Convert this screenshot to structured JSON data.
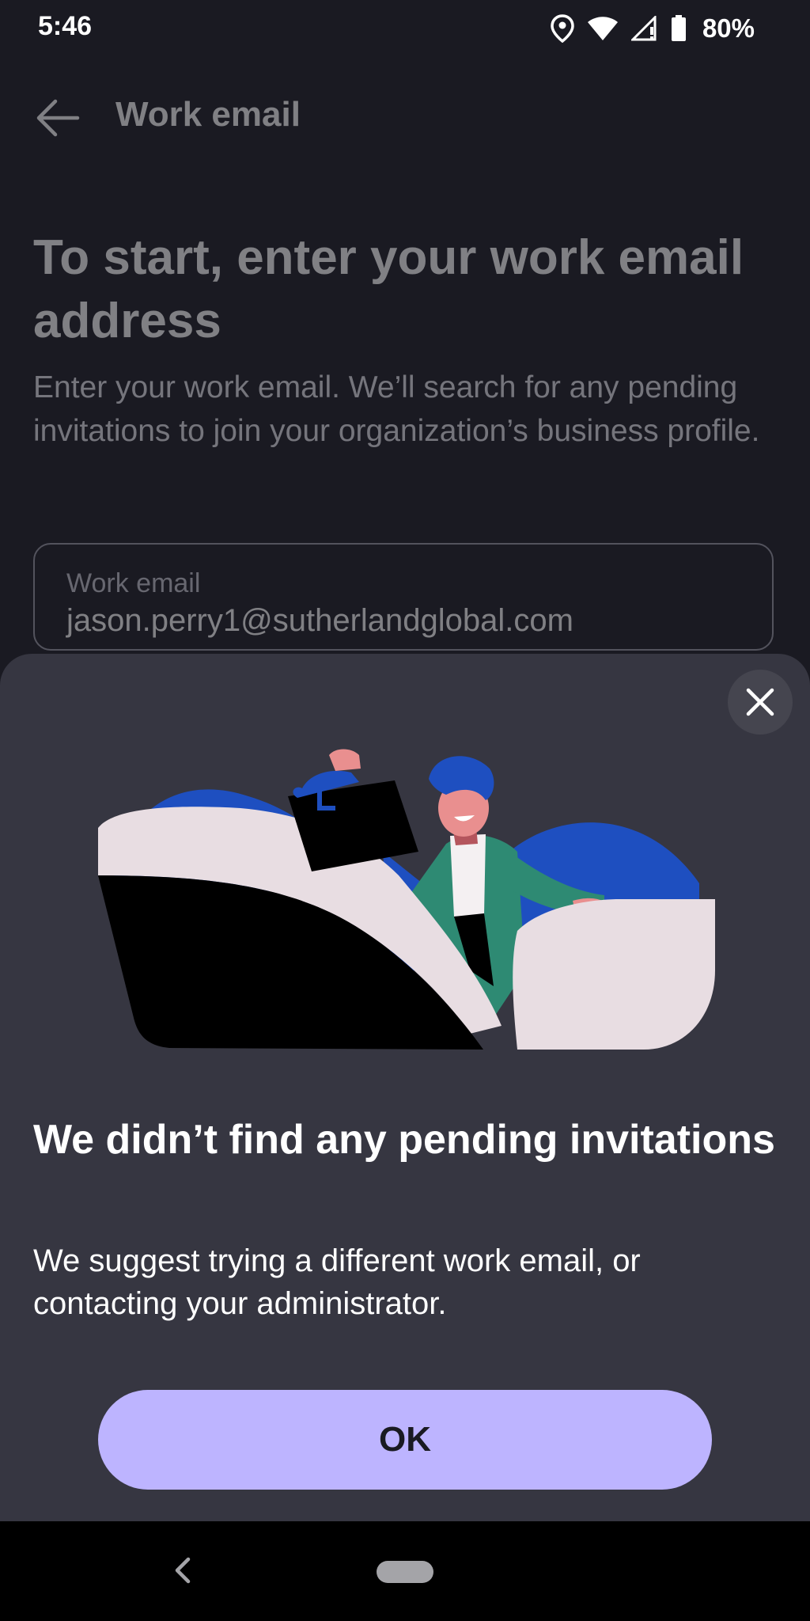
{
  "status_bar": {
    "time": "5:46",
    "battery": "80%",
    "icons": [
      "location-icon",
      "wifi-icon",
      "signal-icon",
      "battery-icon"
    ]
  },
  "app_bar": {
    "title": "Work email",
    "back_icon": "arrow-left-icon"
  },
  "content": {
    "heading": "To start, enter your work email address",
    "subtext": "Enter your work email. We’ll search for any pending invitations to join your organization’s business profile.",
    "email_field": {
      "label": "Work email",
      "value": "jason.perry1@sutherlandglobal.com"
    }
  },
  "sheet": {
    "close_icon": "close-icon",
    "title": "We didn’t find any pending invitations",
    "body": "We suggest trying a different work email, or contacting your administrator.",
    "ok_label": "OK"
  },
  "colors": {
    "background": "#1a1a22",
    "sheet": "#363641",
    "accent_button": "#bdb4ff",
    "illustration_blue": "#1e4fc0",
    "illustration_green": "#2e8a73",
    "illustration_cream": "#e8dde2",
    "skin": "#e98f8f"
  }
}
